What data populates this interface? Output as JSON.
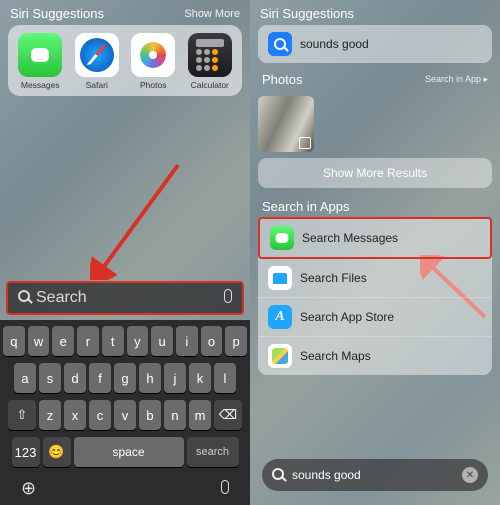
{
  "left": {
    "header": {
      "title": "Siri Suggestions",
      "show_more": "Show More"
    },
    "apps": [
      {
        "label": "Messages"
      },
      {
        "label": "Safari"
      },
      {
        "label": "Photos"
      },
      {
        "label": "Calculator"
      }
    ],
    "search": {
      "placeholder": "Search"
    },
    "keyboard": {
      "r1": [
        "q",
        "w",
        "e",
        "r",
        "t",
        "y",
        "u",
        "i",
        "o",
        "p"
      ],
      "r2": [
        "a",
        "s",
        "d",
        "f",
        "g",
        "h",
        "j",
        "k",
        "l"
      ],
      "r3": [
        "⇧",
        "z",
        "x",
        "c",
        "v",
        "b",
        "n",
        "m",
        "⌫"
      ],
      "r4": {
        "num": "123",
        "emoji": "😊",
        "space": "space",
        "search": "search"
      }
    }
  },
  "right": {
    "siri": {
      "title": "Siri Suggestions",
      "item": "sounds good"
    },
    "photos": {
      "title": "Photos",
      "action": "Search in App ▸"
    },
    "show_more_results": "Show More Results",
    "search_apps": {
      "title": "Search in Apps",
      "items": [
        {
          "label": "Search Messages"
        },
        {
          "label": "Search Files"
        },
        {
          "label": "Search App Store"
        },
        {
          "label": "Search Maps"
        }
      ]
    },
    "search": {
      "value": "sounds good"
    }
  }
}
